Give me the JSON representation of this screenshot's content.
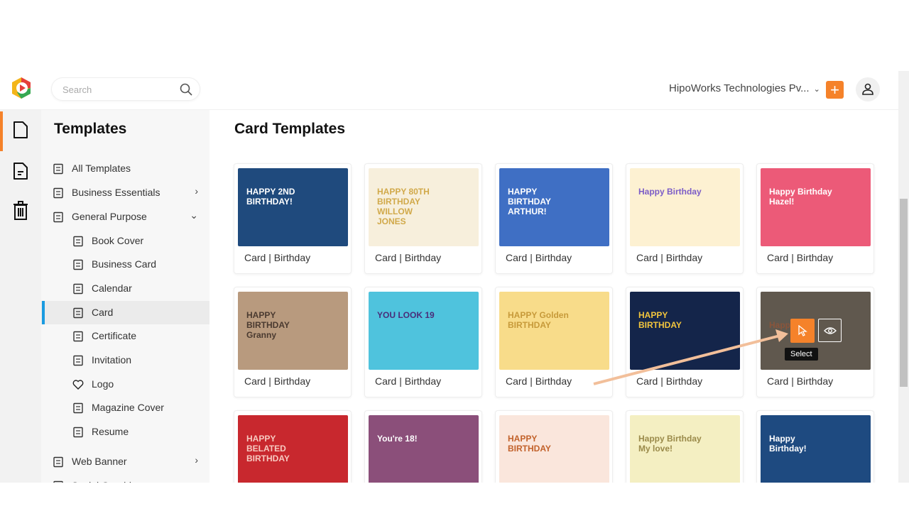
{
  "header": {
    "search_placeholder": "Search",
    "org": "HipoWorks Technologies Pv...",
    "plus": "+"
  },
  "sidebar": {
    "title": "Templates",
    "items": [
      {
        "label": "All Templates",
        "icon": "layout-icon",
        "arrow": ""
      },
      {
        "label": "Business Essentials",
        "icon": "building-icon",
        "arrow": "›"
      },
      {
        "label": "General Purpose",
        "icon": "list-icon",
        "arrow": "⌄"
      },
      {
        "label": "Book Cover",
        "icon": "book-icon",
        "arrow": ""
      },
      {
        "label": "Business Card",
        "icon": "id-card-icon",
        "arrow": ""
      },
      {
        "label": "Calendar",
        "icon": "calendar-icon",
        "arrow": ""
      },
      {
        "label": "Card",
        "icon": "card-icon",
        "arrow": "",
        "active": true
      },
      {
        "label": "Certificate",
        "icon": "award-icon",
        "arrow": ""
      },
      {
        "label": "Invitation",
        "icon": "envelope-icon",
        "arrow": ""
      },
      {
        "label": "Logo",
        "icon": "heart-icon",
        "arrow": ""
      },
      {
        "label": "Magazine Cover",
        "icon": "magazine-icon",
        "arrow": ""
      },
      {
        "label": "Resume",
        "icon": "resume-icon",
        "arrow": ""
      },
      {
        "label": "Web Banner",
        "icon": "banner-icon",
        "arrow": "›"
      },
      {
        "label": "Social Graphic",
        "icon": "share-icon",
        "arrow": "›"
      }
    ]
  },
  "main": {
    "title": "Card Templates",
    "select_tooltip": "Select",
    "cards": [
      {
        "label": "Card | Birthday",
        "text": "HAPPY 2ND BIRTHDAY!",
        "bg": "#1f4a7d",
        "fg": "#ffffff"
      },
      {
        "label": "Card | Birthday",
        "text": "HAPPY 80TH BIRTHDAY WILLOW JONES",
        "bg": "#f7efdc",
        "fg": "#d1a94a"
      },
      {
        "label": "Card | Birthday",
        "text": "HAPPY BIRTHDAY ARTHUR!",
        "bg": "#3f6fc4",
        "fg": "#ffffff"
      },
      {
        "label": "Card | Birthday",
        "text": "Happy Birthday",
        "bg": "#fdf1d2",
        "fg": "#7b5cc7"
      },
      {
        "label": "Card | Birthday",
        "text": "Happy Birthday Hazel!",
        "bg": "#ec5a78",
        "fg": "#ffffff"
      },
      {
        "label": "Card | Birthday",
        "text": "HAPPY BIRTHDAY Granny",
        "bg": "#b89a7e",
        "fg": "#4a3a30"
      },
      {
        "label": "Card | Birthday",
        "text": "YOU LOOK 19",
        "bg": "#4fc3dd",
        "fg": "#4a2d7a"
      },
      {
        "label": "Card | Birthday",
        "text": "HAPPY Golden BIRTHDAY",
        "bg": "#f8dc8a",
        "fg": "#c79a3a"
      },
      {
        "label": "Card | Birthday",
        "text": "HAPPY BIRTHDAY",
        "bg": "#14254a",
        "fg": "#f2c53d"
      },
      {
        "label": "Card | Birthday",
        "text": "Happ",
        "bg": "#8c7a64",
        "fg": "#e8743a",
        "hover": true
      },
      {
        "label": "",
        "text": "HAPPY BELATED BIRTHDAY",
        "bg": "#c8282e",
        "fg": "#f7c9c0"
      },
      {
        "label": "",
        "text": "You're 18!",
        "bg": "#8b4f7a",
        "fg": "#ffffff"
      },
      {
        "label": "",
        "text": "HAPPY BIRTHDAY",
        "bg": "#fae6dc",
        "fg": "#c2622b"
      },
      {
        "label": "",
        "text": "Happy Birthday My love!",
        "bg": "#f4efc2",
        "fg": "#9a8a4a"
      },
      {
        "label": "",
        "text": "Happy Birthday!",
        "bg": "#1e4a80",
        "fg": "#ffffff"
      }
    ]
  },
  "colors": {
    "accent": "#f5822a",
    "active": "#1a9be0",
    "annotation_arrow": "#f2bf9a"
  }
}
